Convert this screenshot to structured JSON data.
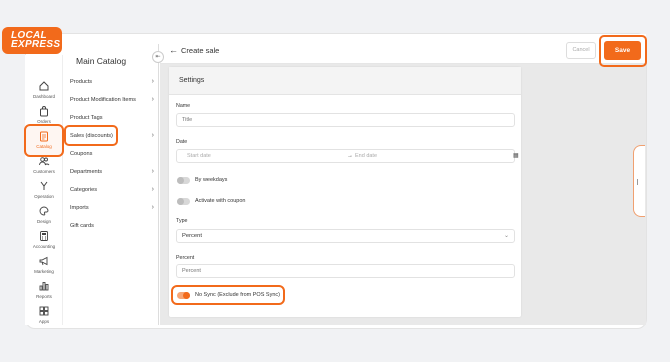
{
  "logo": {
    "line1": "LOCAL",
    "line2": "EXPRESS"
  },
  "rail": [
    {
      "label": "Dashboard",
      "icon": "home-icon"
    },
    {
      "label": "Orders",
      "icon": "bag-icon"
    },
    {
      "label": "Catalog",
      "icon": "clipboard-icon"
    },
    {
      "label": "Customers",
      "icon": "users-icon"
    },
    {
      "label": "Operation",
      "icon": "wrench-icon"
    },
    {
      "label": "Design",
      "icon": "palette-icon"
    },
    {
      "label": "Accounting",
      "icon": "calculator-icon"
    },
    {
      "label": "Marketing",
      "icon": "megaphone-icon"
    },
    {
      "label": "Reports",
      "icon": "bar-chart-icon"
    },
    {
      "label": "Apps",
      "icon": "grid-icon"
    }
  ],
  "catalog": {
    "title": "Main Catalog",
    "items": [
      {
        "label": "Products",
        "chevron": true
      },
      {
        "label": "Product Modification Items",
        "chevron": true
      },
      {
        "label": "Product Tags",
        "chevron": false
      },
      {
        "label": "Sales (discounts)",
        "chevron": true
      },
      {
        "label": "Coupons",
        "chevron": false
      },
      {
        "label": "Departments",
        "chevron": true
      },
      {
        "label": "Categories",
        "chevron": true
      },
      {
        "label": "Imports",
        "chevron": true
      },
      {
        "label": "Gift cards",
        "chevron": false
      }
    ]
  },
  "header": {
    "title": "Create sale",
    "cancel_label": "Cancel",
    "save_label": "Save"
  },
  "settings": {
    "title": "Settings",
    "name_label": "Name",
    "name_placeholder": "Title",
    "date_label": "Date",
    "start_placeholder": "Start date",
    "end_placeholder": "End date",
    "by_weekdays_label": "By weekdays",
    "by_weekdays_on": false,
    "coupon_label": "Activate with coupon",
    "coupon_on": false,
    "type_label": "Type",
    "type_value": "Percent",
    "percent_label": "Percent",
    "percent_placeholder": "Percent",
    "nosync_label": "No Sync (Exclude from POS Sync)",
    "nosync_on": true
  },
  "colors": {
    "accent": "#f26a1b"
  }
}
